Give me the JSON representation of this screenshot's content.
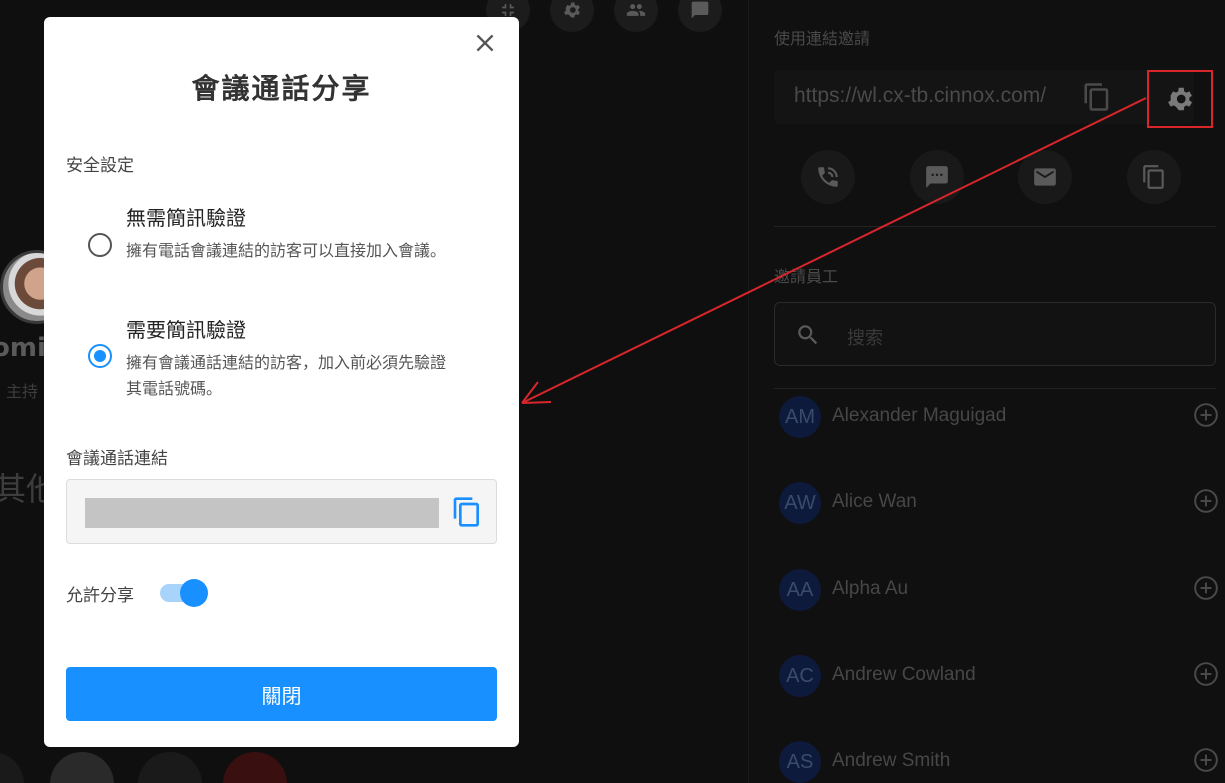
{
  "call_area": {
    "partial_name": "omi",
    "partial_role": "主持",
    "partial_text": "其他"
  },
  "right_panel": {
    "invite_link_label": "使用連結邀請",
    "invite_link_url": "https://wl.cx-tb.cinnox.com/",
    "invite_staff_label": "邀請員工",
    "search_placeholder": "搜索",
    "contacts": [
      {
        "initials": "AM",
        "name": "Alexander Maguigad"
      },
      {
        "initials": "AW",
        "name": "Alice Wan"
      },
      {
        "initials": "AA",
        "name": "Alpha Au"
      },
      {
        "initials": "AC",
        "name": "Andrew Cowland"
      },
      {
        "initials": "AS",
        "name": "Andrew Smith"
      }
    ]
  },
  "modal": {
    "title": "會議通話分享",
    "security_label": "安全設定",
    "options": [
      {
        "title": "無需簡訊驗證",
        "desc": "擁有電話會議連結的訪客可以直接加入會議。",
        "checked": false
      },
      {
        "title": "需要簡訊驗證",
        "desc": "擁有會議通話連結的訪客，加入前必須先驗證其電話號碼。",
        "checked": true
      }
    ],
    "link_label": "會議通話連結",
    "allow_share_label": "允許分享",
    "allow_share_on": true,
    "close_label": "關閉"
  },
  "colors": {
    "accent": "#1890ff",
    "highlight": "#d9262b"
  }
}
